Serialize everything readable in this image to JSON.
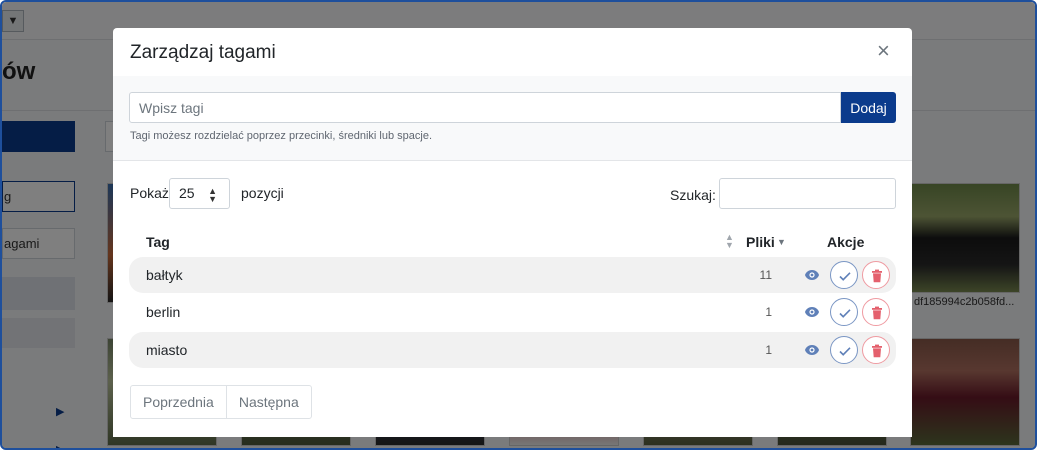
{
  "background": {
    "dropdown_glyph": "▼",
    "heading_fragment": "ów",
    "item1_text": "g",
    "item2_text": "agami",
    "thumb_caption": "df185994c2b058fd..."
  },
  "modal": {
    "title": "Zarządzaj tagami",
    "close_glyph": "×",
    "add": {
      "placeholder": "Wpisz tagi",
      "button_label": "Dodaj",
      "hint": "Tagi możesz rozdzielać poprzez przecinki, średniki lub spacje."
    },
    "table_controls": {
      "show_label": "Pokaż",
      "page_length": "25",
      "show_suffix": "pozycji",
      "search_label": "Szukaj:"
    },
    "columns": {
      "tag": "Tag",
      "files": "Pliki",
      "actions": "Akcje"
    },
    "rows": [
      {
        "tag": "bałtyk",
        "count": "11"
      },
      {
        "tag": "berlin",
        "count": "1"
      },
      {
        "tag": "miasto",
        "count": "1"
      }
    ],
    "pagination": {
      "previous": "Poprzednia",
      "next": "Następna"
    }
  },
  "colors": {
    "primary": "#0b3b8c",
    "check_outline": "#7a96c4",
    "delete_red": "#e4606d",
    "eye_icon": "#5f80b8"
  },
  "icons": [
    "close-icon",
    "sort-icon",
    "eye-icon",
    "check-icon",
    "trash-icon"
  ]
}
